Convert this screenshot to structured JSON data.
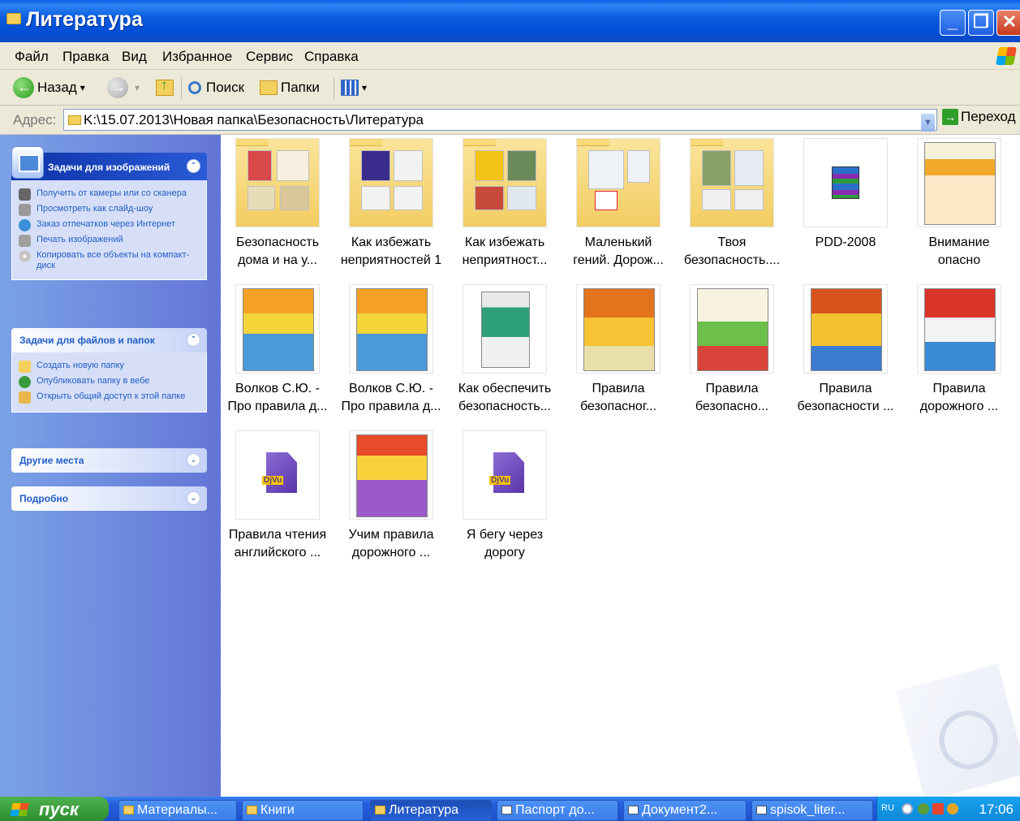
{
  "window": {
    "title": "Литература"
  },
  "menu": [
    "Файл",
    "Правка",
    "Вид",
    "Избранное",
    "Сервис",
    "Справка"
  ],
  "toolbar": {
    "back": "Назад",
    "search": "Поиск",
    "folders": "Папки"
  },
  "address": {
    "label": "Адрес:",
    "path": "K:\\15.07.2013\\Новая папка\\Безопасность\\Литература",
    "go": "Переход"
  },
  "sidebar": {
    "image_tasks": {
      "title": "Задачи для изображений",
      "items": [
        "Получить от камеры или со сканера",
        "Просмотреть как слайд-шоу",
        "Заказ отпечатков через Интернет",
        "Печать изображений",
        "Копировать все объекты на компакт-диск"
      ]
    },
    "file_tasks": {
      "title": "Задачи для файлов и папок",
      "items": [
        "Создать новую папку",
        "Опубликовать папку в вебе",
        "Открыть общий доступ к этой папке"
      ]
    },
    "other_places": {
      "title": "Другие места"
    },
    "details": {
      "title": "Подробно"
    }
  },
  "files": [
    {
      "line1": "Безопасность",
      "line2": "дома и на у...",
      "kind": "folder"
    },
    {
      "line1": "Как избежать",
      "line2": "неприятностей 1",
      "kind": "folder"
    },
    {
      "line1": "Как избежать",
      "line2": "неприятност...",
      "kind": "folder"
    },
    {
      "line1": "Маленький",
      "line2": "гений. Дорож...",
      "kind": "folder"
    },
    {
      "line1": "Твоя",
      "line2": "безопасность....",
      "kind": "folder"
    },
    {
      "line1": "PDD-2008",
      "line2": "",
      "kind": "archive"
    },
    {
      "line1": "Внимание",
      "line2": "опасно",
      "kind": "book"
    },
    {
      "line1": "Волков С.Ю. -",
      "line2": "Про правила д...",
      "kind": "book"
    },
    {
      "line1": "Волков С.Ю. -",
      "line2": "Про правила д...",
      "kind": "book"
    },
    {
      "line1": "Как обеспечить",
      "line2": "безопасность...",
      "kind": "book"
    },
    {
      "line1": "Правила",
      "line2": "безопасног...",
      "kind": "book"
    },
    {
      "line1": "Правила",
      "line2": "безопасно...",
      "kind": "book"
    },
    {
      "line1": "Правила",
      "line2": "безопасности ...",
      "kind": "book"
    },
    {
      "line1": "Правила",
      "line2": "дорожного ...",
      "kind": "book"
    },
    {
      "line1": "Правила чтения",
      "line2": "английского ...",
      "kind": "djvu"
    },
    {
      "line1": "Учим правила",
      "line2": "дорожного ...",
      "kind": "book"
    },
    {
      "line1": "Я бегу через",
      "line2": "дорогу",
      "kind": "djvu"
    }
  ],
  "taskbar": {
    "start": "пуск",
    "buttons": [
      "Материалы...",
      "Книги",
      "Литература",
      "Паспорт до...",
      "Документ2...",
      "spisok_liter..."
    ],
    "lang": "RU",
    "clock": "17:06"
  }
}
